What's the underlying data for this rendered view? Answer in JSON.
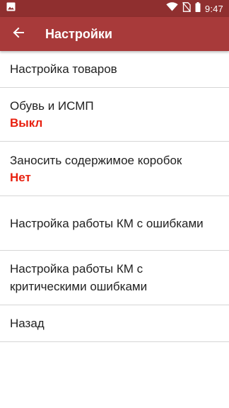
{
  "status_bar": {
    "time": "9:47",
    "icons": [
      "image-icon",
      "wifi-icon",
      "no-sim-icon",
      "battery-icon"
    ]
  },
  "app_bar": {
    "title": "Настройки",
    "back_icon": "arrow-left-icon"
  },
  "menu": {
    "items": [
      {
        "label": "Настройка товаров"
      },
      {
        "label": "Обувь и ИСМП",
        "value": "Выкл"
      },
      {
        "label": "Заносить содержимое коробок",
        "value": "Нет"
      },
      {
        "label": "Настройка работы КМ с ошибками"
      },
      {
        "label": "Настройка работы КМ с критическими ошибками"
      },
      {
        "label": "Назад"
      }
    ]
  },
  "colors": {
    "status_bar": "#8f2f2f",
    "app_bar": "#a83a3a",
    "value_text": "#e8200f"
  }
}
